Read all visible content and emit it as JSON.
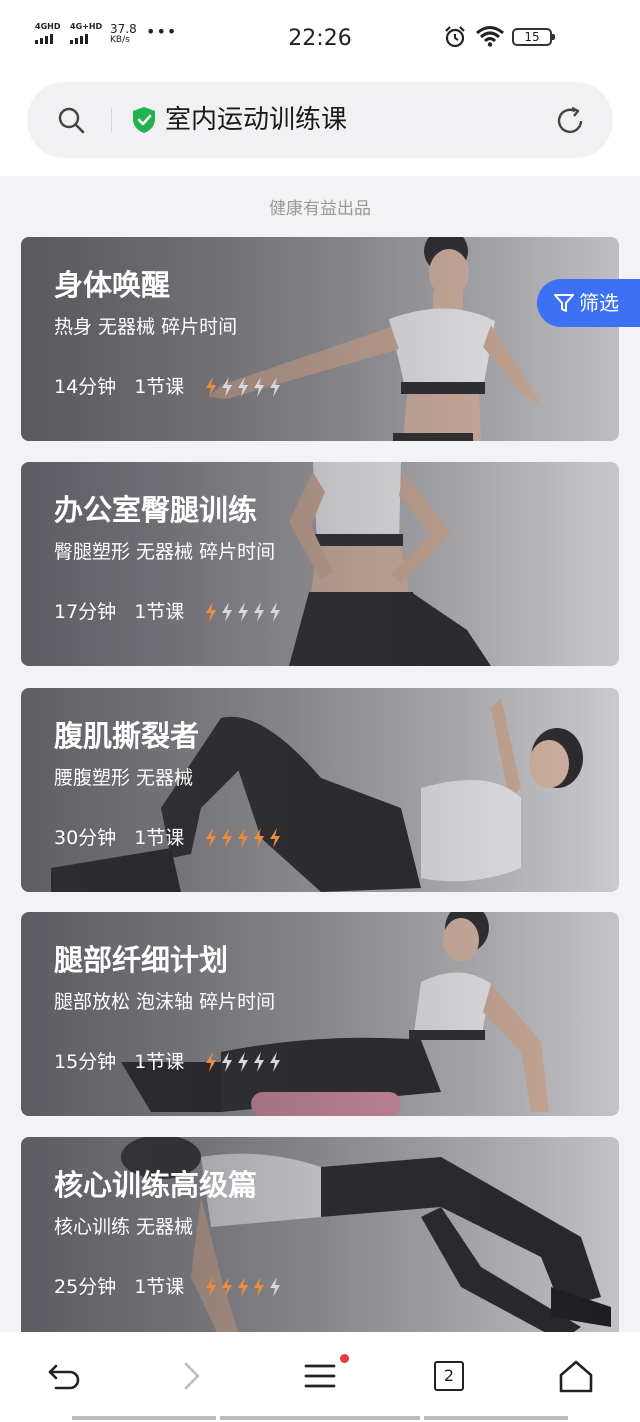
{
  "status_bar": {
    "signal1": "4GHD",
    "signal2": "4G+HD",
    "speed_value": "37.8",
    "speed_unit": "KB/s",
    "time": "22:26",
    "battery": "15"
  },
  "search": {
    "title": "室内运动训练课"
  },
  "provider_label": "健康有益出品",
  "filter_label": "筛选",
  "cards": [
    {
      "title": "身体唤醒",
      "tags": "热身 无器械 碎片时间",
      "duration": "14分钟",
      "lessons": "1节课",
      "intensity": 1
    },
    {
      "title": "办公室臀腿训练",
      "tags": "臀腿塑形 无器械 碎片时间",
      "duration": "17分钟",
      "lessons": "1节课",
      "intensity": 1
    },
    {
      "title": "腹肌撕裂者",
      "tags": "腰腹塑形 无器械",
      "duration": "30分钟",
      "lessons": "1节课",
      "intensity": 5
    },
    {
      "title": "腿部纤细计划",
      "tags": "腿部放松 泡沫轴 碎片时间",
      "duration": "15分钟",
      "lessons": "1节课",
      "intensity": 1
    },
    {
      "title": "核心训练高级篇",
      "tags": "核心训练 无器械",
      "duration": "25分钟",
      "lessons": "1节课",
      "intensity": 4
    }
  ],
  "bottom_nav": {
    "tab_count": "2"
  },
  "colors": {
    "accent": "#3c71f5",
    "bolt_active": "#f08a3c",
    "bolt_inactive": "#d9d9dc",
    "shield": "#22b14c",
    "notification": "#e83a3a"
  }
}
